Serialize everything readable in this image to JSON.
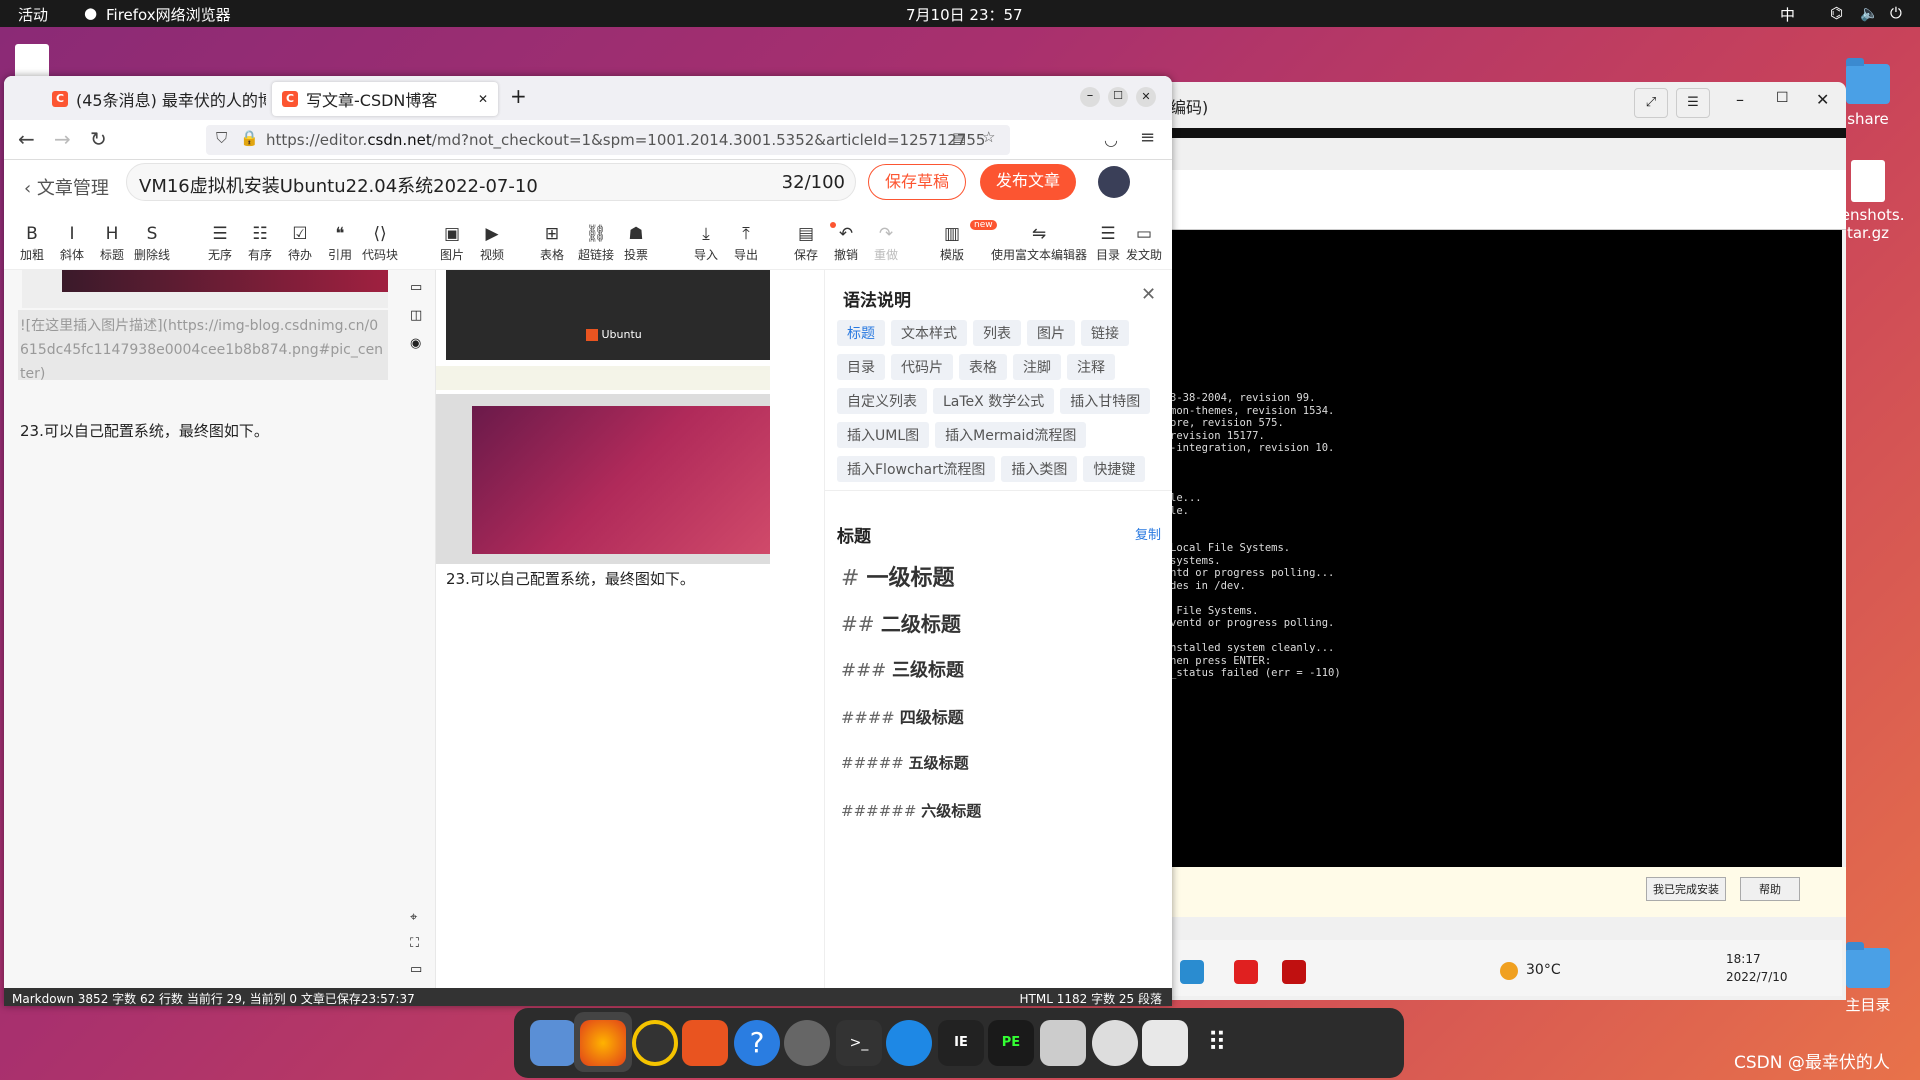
{
  "topbar": {
    "activities": "活动",
    "app": "Firefox网络浏览器",
    "clock": "7月10日 23：57",
    "ime": "中"
  },
  "desktop": {
    "share": "share",
    "screenshots": "eenshots.\ntar.gz",
    "home": "主目录"
  },
  "watermark": "CSDN @最幸伏的人",
  "vm": {
    "title": "编码)",
    "done_btn": "我已完成安装",
    "help_btn": "帮助",
    "temp": "30°C",
    "time": "18:17",
    "date": "2022/7/10",
    "terminal": "3-38-2004, revision 99.\nmon-themes, revision 1534.\nore, revision 575.\nrevision 15177.\n-integration, revision 10.\n\n\n\nle...\nle.\n\n\nLocal File Systems.\nsystems.\nntd or progress polling...\ndes in /dev.\n\n File Systems.\nventd or progress polling.\n\nnstalled system cleanly...\nhen press ENTER:\n_status failed (err = -110)"
  },
  "browser": {
    "tab1": "(45条消息) 最幸伏的人的博",
    "tab2": "写文章-CSDN博客",
    "url_pre": "https://editor.",
    "url_host": "csdn.net",
    "url_post": "/md?not_checkout=1&spm=1001.2014.3001.5352&articleId=125712755"
  },
  "editor": {
    "back": "文章管理",
    "title": "VM16虚拟机安装Ubuntu22.04系统2022-07-10",
    "counter": "32/100",
    "save": "保存草稿",
    "publish": "发布文章",
    "toolbar": [
      "加粗",
      "斜体",
      "标题",
      "删除线",
      "无序",
      "有序",
      "待办",
      "引用",
      "代码块",
      "图片",
      "视频",
      "表格",
      "超链接",
      "投票",
      "导入",
      "导出",
      "保存",
      "撤销",
      "重做",
      "模版",
      "使用富文本编辑器",
      "目录",
      "发文助"
    ],
    "new_badge": "new",
    "md_text": "![在这里插入图片描述](https://img-blog.csdnimg.cn/0615dc45fc1147938e0004cee1b8b874.png#pic_center)",
    "md_line23": "23.可以自己配置系统，最终图如下。",
    "preview_line23": "23.可以自己配置系统，最终图如下。",
    "ubuntu_label": "Ubuntu"
  },
  "syntax": {
    "title": "语法说明",
    "chips": [
      "标题",
      "文本样式",
      "列表",
      "图片",
      "链接",
      "目录",
      "代码片",
      "表格",
      "注脚",
      "注释",
      "自定义列表",
      "LaTeX 数学公式",
      "插入甘特图",
      "插入UML图",
      "插入Mermaid流程图",
      "插入Flowchart流程图",
      "插入类图",
      "快捷键"
    ],
    "section": "标题",
    "copy": "复制",
    "headings": [
      {
        "m": "#",
        "t": "一级标题"
      },
      {
        "m": "##",
        "t": "二级标题"
      },
      {
        "m": "###",
        "t": "三级标题"
      },
      {
        "m": "####",
        "t": "四级标题"
      },
      {
        "m": "#####",
        "t": "五级标题"
      },
      {
        "m": "######",
        "t": "六级标题"
      }
    ]
  },
  "status": {
    "left": "Markdown  3852 字数   62 行数   当前行 29, 当前列 0   文章已保存23:57:37",
    "right": "HTML  1182 字数   25 段落"
  },
  "colors": {
    "csdn_red": "#fc5531",
    "chip_active": "#2979e0"
  }
}
